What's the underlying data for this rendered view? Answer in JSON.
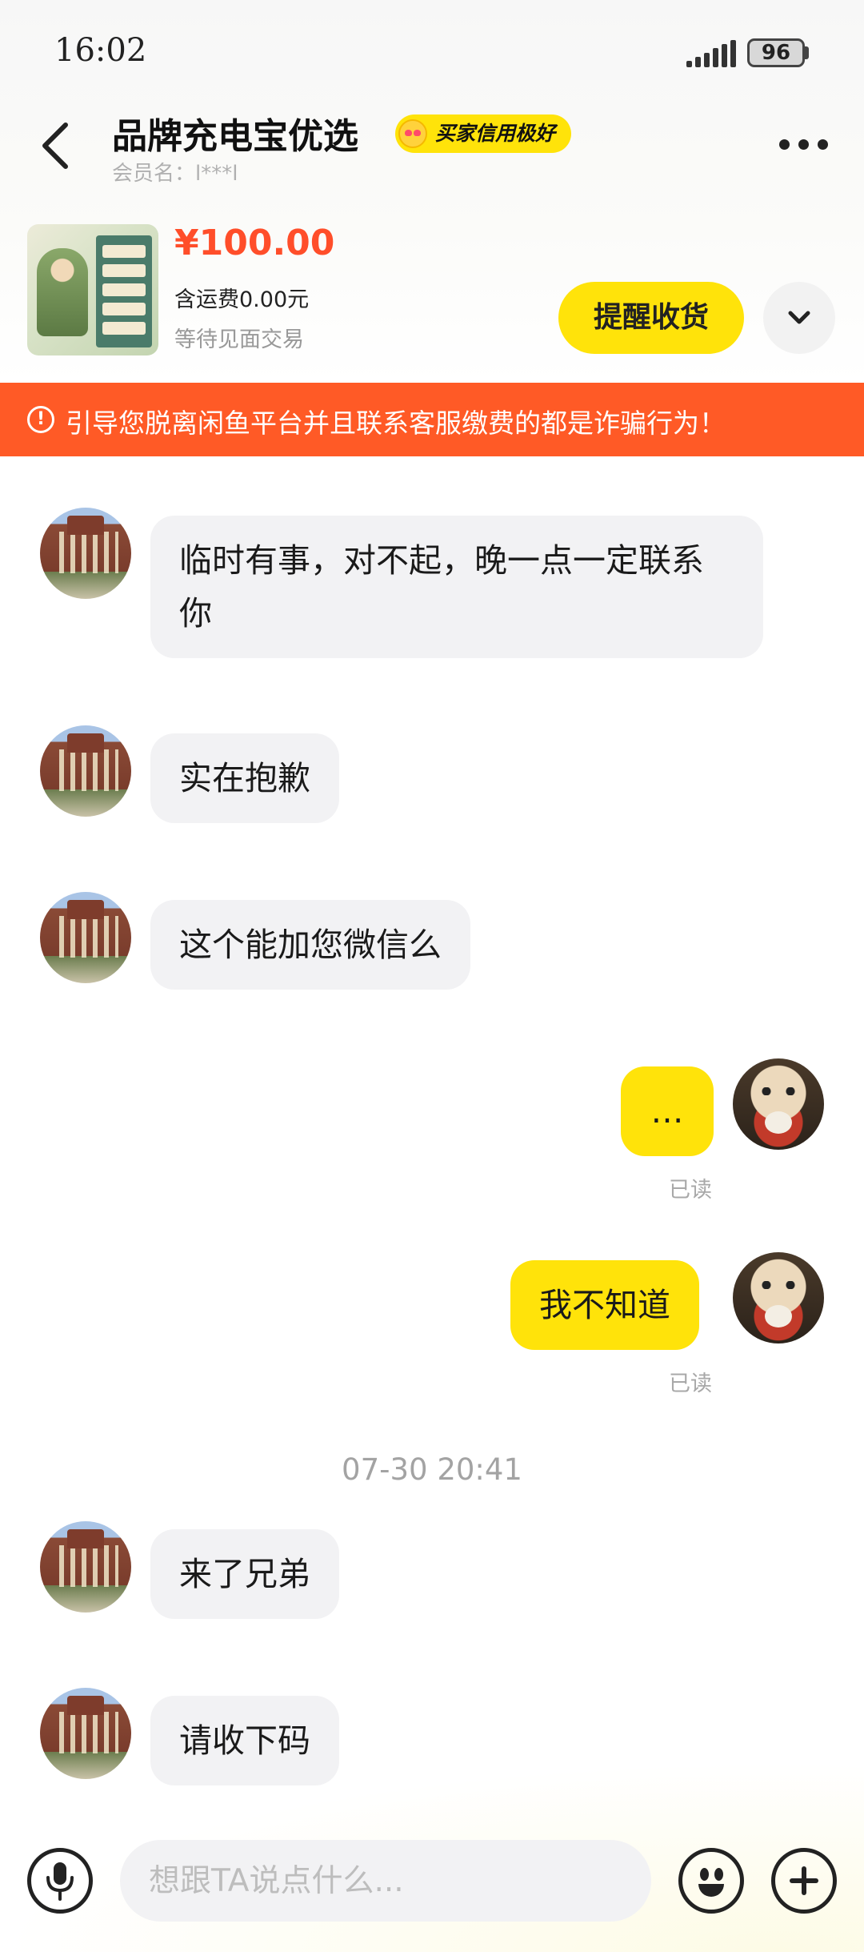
{
  "status_bar": {
    "time": "16:02",
    "battery": "96",
    "icons": [
      "signal-icon",
      "battery-icon"
    ]
  },
  "header": {
    "title": "品牌充电宝优选",
    "badge": "买家信用极好",
    "member_label": "会员名：l***l",
    "icons": [
      "back-arrow-icon",
      "more-icon",
      "heart-eyes-emoji-icon"
    ]
  },
  "product": {
    "price": "¥100.00",
    "shipping": "含运费0.00元",
    "deal_type": "等待见面交易",
    "remind_button": "提醒收货",
    "expand_icon": "chevron-down-icon"
  },
  "warning": {
    "icon": "exclamation-circle-icon",
    "text": "引导您脱离闲鱼平台并且联系客服缴费的都是诈骗行为！",
    "color": "#ff5a26"
  },
  "messages": [
    {
      "side": "in",
      "text": "临时有事，对不起，晚一点一定联系你"
    },
    {
      "side": "in",
      "text": "实在抱歉"
    },
    {
      "side": "in",
      "text": "这个能加您微信么"
    },
    {
      "side": "out",
      "text": "…",
      "status": "已读"
    },
    {
      "side": "out",
      "text": "我不知道",
      "status": "已读"
    },
    {
      "side": "in",
      "text": "来了兄弟"
    },
    {
      "side": "in",
      "text": "请收下码"
    }
  ],
  "timestamp": "07-30 20:41",
  "input_bar": {
    "placeholder": "想跟TA说点什么...",
    "icons": [
      "microphone-icon",
      "emoji-icon",
      "plus-icon"
    ]
  },
  "colors": {
    "accent_yellow": "#ffe30a",
    "price_red": "#ff4e2a",
    "incoming_bubble": "#f2f2f4"
  }
}
